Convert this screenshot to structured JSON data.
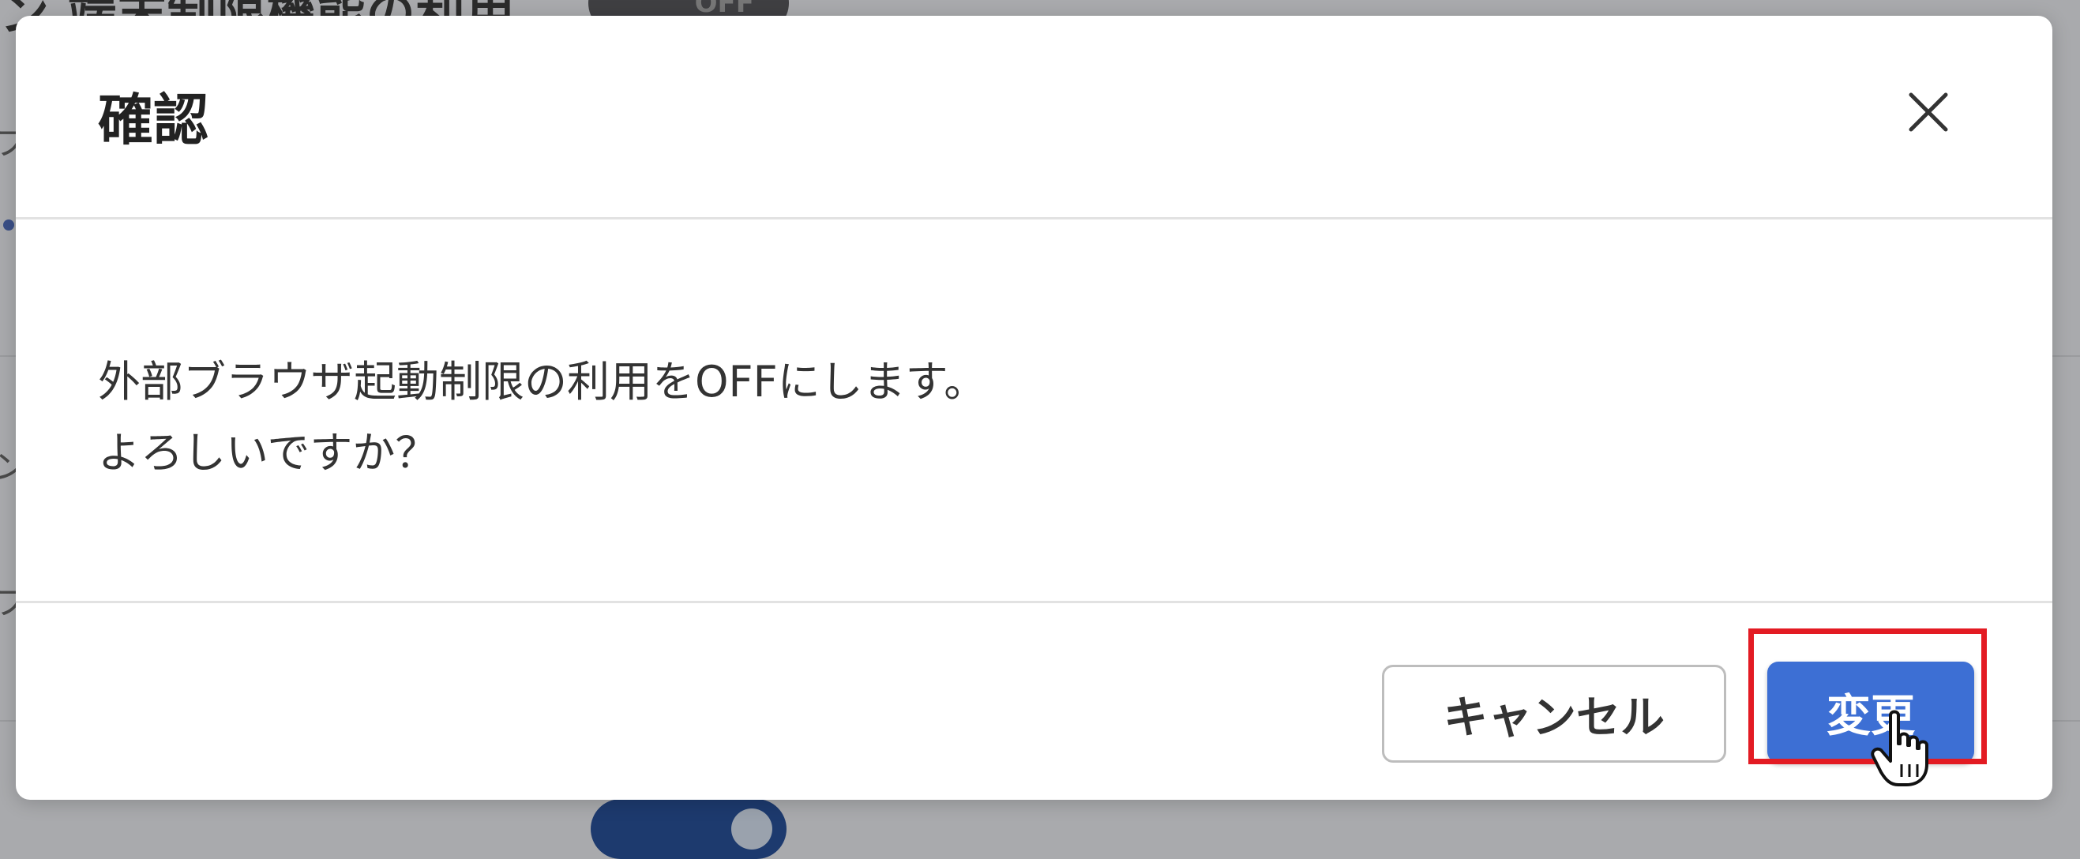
{
  "background": {
    "heading": "ン 端末制限機能の利用",
    "toggle_label": "OFF",
    "edge_chars": [
      "フ",
      "ン",
      "フ"
    ]
  },
  "dialog": {
    "title": "確認",
    "close_icon": "close-icon",
    "message_lines": [
      "外部ブラウザ起動制限の利用をOFFにします。",
      "よろしいですか？"
    ],
    "cancel_label": "キャンセル",
    "confirm_label": "変更"
  },
  "colors": {
    "overlay": "#a9aaad",
    "primary": "#3d6fd4",
    "highlight": "#e31b23",
    "text": "#333333"
  },
  "annotations": {
    "highlight": "red-box-around-confirm-button",
    "cursor_icon": "hand-pointer-icon"
  }
}
